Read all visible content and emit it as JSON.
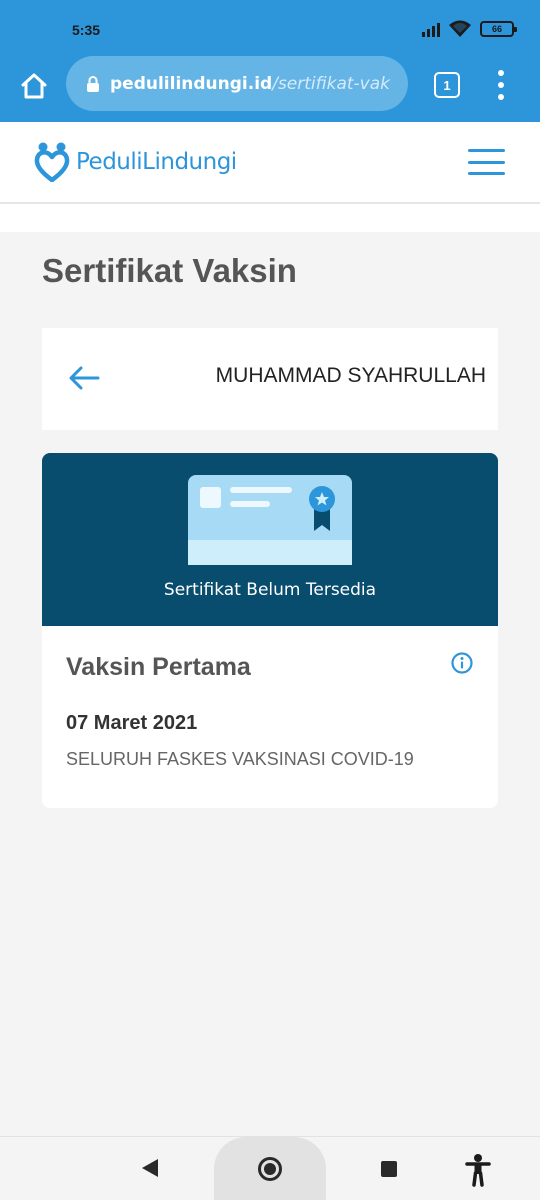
{
  "status_bar": {
    "time": "5:35",
    "battery": "66",
    "icons": [
      "signal-icon",
      "wifi-icon",
      "battery-icon"
    ]
  },
  "browser": {
    "url_host": "pedulilindungi.id",
    "url_path": "/sertifikat-vak",
    "tab_count": "1",
    "accent_color": "#2d95da"
  },
  "site": {
    "logo_text": "PeduliLindungi",
    "brand_color": "#2d95da"
  },
  "page": {
    "title": "Sertifikat Vaksin"
  },
  "person": {
    "name": "MUHAMMAD SYAHRULLAH"
  },
  "certificate": {
    "status": "Sertifikat Belum Tersedia",
    "banner_color": "#084d6e",
    "dose_title": "Vaksin Pertama",
    "date": "07 Maret 2021",
    "location": "SELURUH FASKES VAKSINASI COVID-19"
  },
  "nav": {
    "icons": [
      "back-icon",
      "home-icon",
      "recent-apps-icon",
      "accessibility-icon"
    ]
  }
}
